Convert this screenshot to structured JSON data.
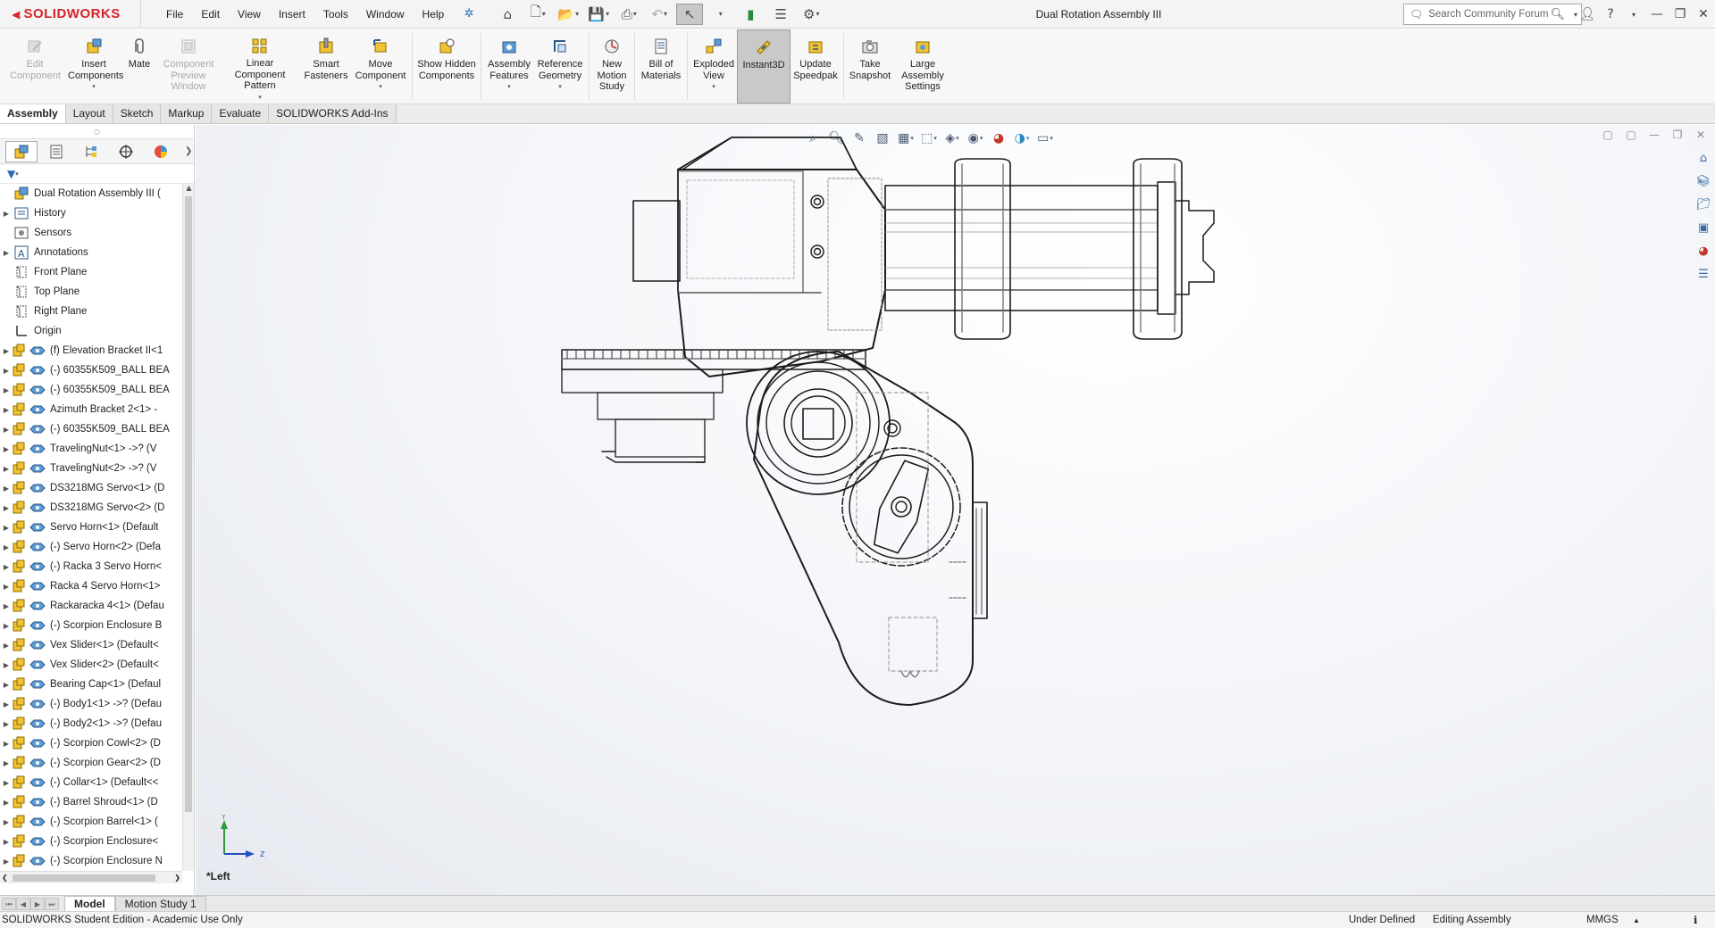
{
  "app": {
    "brand": "SOLIDWORKS",
    "accent": "#d8232a",
    "document_title": "Dual Rotation Assembly III"
  },
  "menu": [
    "File",
    "Edit",
    "View",
    "Insert",
    "Tools",
    "Window",
    "Help"
  ],
  "search": {
    "placeholder": "Search Community Forum"
  },
  "ribbon": {
    "edit_component": "Edit Component",
    "insert_components": "Insert Components",
    "mate": "Mate",
    "component_preview": "Component Preview Window",
    "linear_pattern": "Linear Component Pattern",
    "smart_fasteners": "Smart Fasteners",
    "move_component": "Move Component",
    "show_hidden": "Show Hidden Components",
    "assembly_features": "Assembly Features",
    "reference_geometry": "Reference Geometry",
    "new_motion_study": "New Motion Study",
    "bill_of_materials": "Bill of Materials",
    "exploded_view": "Exploded View",
    "instant3d": "Instant3D",
    "update_speedpak": "Update Speedpak",
    "take_snapshot": "Take Snapshot",
    "large_assembly_settings": "Large Assembly Settings"
  },
  "command_tabs": [
    "Assembly",
    "Layout",
    "Sketch",
    "Markup",
    "Evaluate",
    "SOLIDWORKS Add-Ins"
  ],
  "tree": {
    "root": "Dual Rotation Assembly III  (",
    "items": [
      {
        "label": "History",
        "icon": "history-icon",
        "expandable": true
      },
      {
        "label": "Sensors",
        "icon": "sensors-icon",
        "expandable": false
      },
      {
        "label": "Annotations",
        "icon": "annotations-icon",
        "expandable": true
      },
      {
        "label": "Front Plane",
        "icon": "plane-icon",
        "expandable": false
      },
      {
        "label": "Top Plane",
        "icon": "plane-icon",
        "expandable": false
      },
      {
        "label": "Right Plane",
        "icon": "plane-icon",
        "expandable": false
      },
      {
        "label": "Origin",
        "icon": "origin-icon",
        "expandable": false
      },
      {
        "label": "(f) Elevation Bracket II<1",
        "icon": "part-icon",
        "expandable": true
      },
      {
        "label": "(-) 60355K509_BALL BEA",
        "icon": "part-icon",
        "expandable": true
      },
      {
        "label": "(-) 60355K509_BALL BEA",
        "icon": "part-icon",
        "expandable": true
      },
      {
        "label": "Azimuth Bracket 2<1> -",
        "icon": "part-icon",
        "expandable": true
      },
      {
        "label": "(-) 60355K509_BALL BEA",
        "icon": "part-icon",
        "expandable": true
      },
      {
        "label": "TravelingNut<1> ->? (V",
        "icon": "part-icon",
        "expandable": true
      },
      {
        "label": "TravelingNut<2> ->? (V",
        "icon": "part-icon",
        "expandable": true
      },
      {
        "label": "DS3218MG Servo<1> (D",
        "icon": "part-icon",
        "expandable": true
      },
      {
        "label": "DS3218MG Servo<2> (D",
        "icon": "part-icon",
        "expandable": true
      },
      {
        "label": "Servo Horn<1> (Default",
        "icon": "part-icon",
        "expandable": true
      },
      {
        "label": "(-) Servo Horn<2> (Defa",
        "icon": "part-icon",
        "expandable": true
      },
      {
        "label": "(-) Racka 3 Servo Horn<",
        "icon": "part-icon",
        "expandable": true
      },
      {
        "label": "Racka 4 Servo Horn<1>",
        "icon": "part-icon",
        "expandable": true
      },
      {
        "label": "Rackaracka 4<1> (Defau",
        "icon": "part-icon",
        "expandable": true
      },
      {
        "label": "(-) Scorpion Enclosure B",
        "icon": "part-icon",
        "expandable": true
      },
      {
        "label": "Vex Slider<1> (Default<",
        "icon": "part-icon",
        "expandable": true
      },
      {
        "label": "Vex Slider<2> (Default<",
        "icon": "part-icon",
        "expandable": true
      },
      {
        "label": "Bearing Cap<1> (Defaul",
        "icon": "part-icon",
        "expandable": true
      },
      {
        "label": "(-) Body1<1> ->? (Defau",
        "icon": "part-icon",
        "expandable": true
      },
      {
        "label": "(-) Body2<1> ->? (Defau",
        "icon": "part-icon",
        "expandable": true
      },
      {
        "label": "(-) Scorpion Cowl<2> (D",
        "icon": "part-icon",
        "expandable": true
      },
      {
        "label": "(-) Scorpion Gear<2> (D",
        "icon": "part-icon",
        "expandable": true
      },
      {
        "label": "(-) Collar<1> (Default<<",
        "icon": "part-icon",
        "expandable": true
      },
      {
        "label": "(-) Barrel Shroud<1> (D",
        "icon": "part-icon",
        "expandable": true
      },
      {
        "label": "(-) Scorpion Barrel<1> (",
        "icon": "part-icon",
        "expandable": true
      },
      {
        "label": "(-) Scorpion Enclosure<",
        "icon": "part-icon",
        "expandable": true
      },
      {
        "label": "(-) Scorpion Enclosure N",
        "icon": "part-icon",
        "expandable": true
      }
    ]
  },
  "viewport": {
    "view_label": "*Left",
    "triad_y": "Y",
    "triad_z": "Z"
  },
  "bottom_tabs": [
    "Model",
    "Motion Study 1"
  ],
  "status": {
    "edition": "SOLIDWORKS Student Edition - Academic Use Only",
    "definition": "Under Defined",
    "mode": "Editing Assembly",
    "units": "MMGS"
  }
}
